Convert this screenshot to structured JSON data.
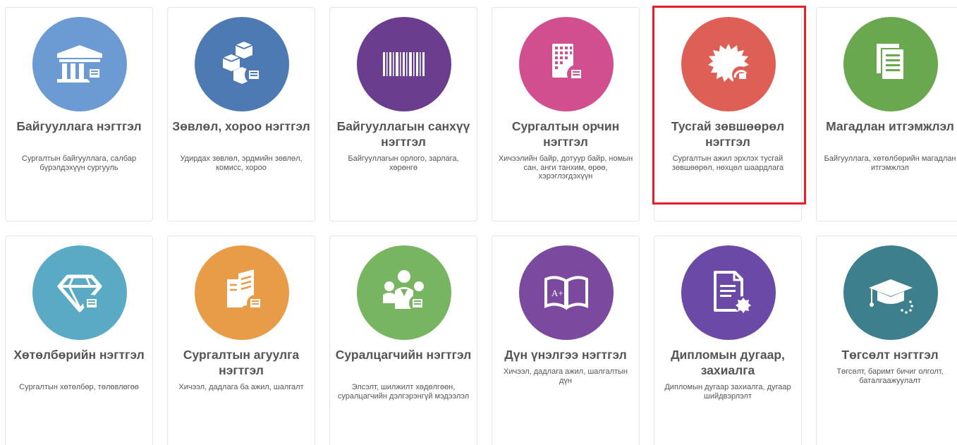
{
  "colors": {
    "c_bank": "#6b9bd2",
    "c_committee": "#4d7ab3",
    "c_finance": "#6a3d8e",
    "c_environment": "#d24f8f",
    "c_license": "#dd5f55",
    "c_accreditation": "#6aa84f",
    "c_curriculum": "#5aaac6",
    "c_content": "#e89c48",
    "c_students": "#77b561",
    "c_grades": "#7b4a9e",
    "c_diploma": "#6a4aa6",
    "c_graduation": "#3d7f8c",
    "highlight": "#e5202a"
  },
  "cards": [
    {
      "title": "Байгууллага нэгтгэл",
      "desc": "Сургалтын байгууллага, салбар бүрэлдэхүүн сургууль",
      "icon": "institution-building-icon"
    },
    {
      "title": "Зөвлөл, хороо нэгтгэл",
      "desc": "Удирдах зөвлөл, эрдмийн зөвлөл, комисс, хороо",
      "icon": "cubes-icon"
    },
    {
      "title": "Байгууллагын санхүү нэгтгэл",
      "desc": "Байгууллагын орлого, зарлага, хөрөнгө",
      "icon": "barcode-icon"
    },
    {
      "title": "Сургалтын орчин нэгтгэл",
      "desc": "Хичээлийн байр, дотуур байр, номын сан, анги танхим, өрөө, хэрэглэгдэхүүн",
      "icon": "building-grid-icon"
    },
    {
      "title": "Тусгай зөвшөөрөл нэгтгэл",
      "desc": "Сургалтын ажил эрхлэх тусгай зөвшөөрөл, нөхцөл шаардлага",
      "icon": "certificate-seal-icon"
    },
    {
      "title": "Магадлан итгэмжлэл",
      "desc": "Байгууллага, хөтөлбөрийн магадлан итгэмжлэл",
      "icon": "documents-icon"
    },
    {
      "title": "Хөтөлбөрийн нэгтгэл",
      "desc": "Сургалтын хөтөлбөр, төлөвлөгөө",
      "icon": "diamond-icon"
    },
    {
      "title": "Сургалтын агуулга нэгтгэл",
      "desc": "Хичээл, дадлага ба ажил, шалгалт",
      "icon": "book-content-icon"
    },
    {
      "title": "Суралцагчийн нэгтгэл",
      "desc": "Элсэлт, шилжилт хөдөлгөөн, суралцагчийн дэлгэрэнгүй мэдээлэл",
      "icon": "students-group-icon"
    },
    {
      "title": "Дүн үнэлгээ нэгтгэл",
      "desc": "Хичээл, дадлага ажил, шалгалтын дүн",
      "icon": "open-book-grade-icon"
    },
    {
      "title": "Дипломын дугаар, захиалга",
      "desc": "Дипломын дугаар захиалга, дугаар шийдвэрлэлт",
      "icon": "document-seal-icon"
    },
    {
      "title": "Төгсөлт нэгтгэл",
      "desc": "Төгсөлт, баримт бичиг олголт, баталгаажуулалт",
      "icon": "graduation-cap-icon"
    }
  ]
}
